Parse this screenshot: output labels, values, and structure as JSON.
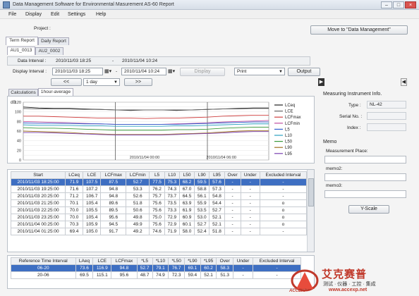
{
  "window": {
    "title": "Data Management Software for Environmental Masurement AS-60 Report"
  },
  "menu": [
    "File",
    "Display",
    "Edit",
    "Settings",
    "Help"
  ],
  "project": {
    "label": "Project :",
    "value": ""
  },
  "move_button": "Move to \"Data Management\"",
  "main_tabs": [
    {
      "label": "Term Report"
    },
    {
      "label": "Daily Report"
    }
  ],
  "sub_tabs": [
    {
      "label": "AU1_0013"
    },
    {
      "label": "AU2_0002"
    }
  ],
  "data_interval": {
    "label": "Data Interval :",
    "start": "2010/11/03 18:25",
    "sep": "-",
    "end": "2010/11/04 10:24"
  },
  "display_interval": {
    "label": "Display Interval :",
    "start": "2010/11/03 18:25",
    "sep": "-",
    "end": "2010/11/04 10:24",
    "display_button": "Display"
  },
  "print": {
    "selected": "Print",
    "output_button": "Output"
  },
  "nav": {
    "prev": "<<",
    "step": "1 day",
    "next": ">>"
  },
  "chart_tabs": [
    {
      "label": "Calculations"
    },
    {
      "label": "1hour-average"
    }
  ],
  "chart_data": {
    "type": "line",
    "ylabel": "dB",
    "ylim": [
      0,
      120
    ],
    "yticks": [
      0,
      10,
      20,
      30,
      40,
      50,
      60,
      70,
      80,
      90,
      100,
      110,
      120
    ],
    "x_labels": [
      "2010/11/03 18:00",
      "2010/11/04 00:00",
      "2010/11/04 06:00"
    ],
    "x_hours": [
      0,
      1,
      2,
      3,
      4,
      5,
      6,
      7,
      8,
      9,
      10,
      11,
      12,
      13,
      14,
      15,
      16
    ],
    "legend_position": "right",
    "series": [
      {
        "name": "LCeq",
        "color": "#222222",
        "values": [
          110,
          108,
          107,
          107,
          106,
          105,
          104,
          103,
          104,
          104,
          103,
          104,
          105,
          106,
          107,
          108,
          108
        ]
      },
      {
        "name": "LCE",
        "color": "#666666",
        "values": [
          107,
          106,
          106,
          106,
          105,
          105,
          104,
          104,
          104,
          104,
          104,
          104,
          105,
          106,
          106,
          107,
          107
        ]
      },
      {
        "name": "LCFmax",
        "color": "#d04040",
        "values": [
          91,
          91,
          90,
          89,
          88,
          87,
          87,
          87,
          86,
          87,
          87,
          88,
          89,
          91,
          92,
          93,
          93
        ]
      },
      {
        "name": "LCFmin",
        "color": "#c04fa0",
        "values": [
          80,
          79,
          78,
          77,
          76,
          75,
          74,
          74,
          74,
          74,
          75,
          76,
          77,
          79,
          80,
          81,
          82
        ]
      },
      {
        "name": "L5",
        "color": "#2f5fd0",
        "values": [
          77,
          76,
          76,
          76,
          75,
          75,
          74,
          74,
          74,
          74,
          74,
          75,
          76,
          77,
          78,
          79,
          79
        ]
      },
      {
        "name": "L10",
        "color": "#2aa0c0",
        "values": [
          73,
          72,
          72,
          72,
          71,
          71,
          70,
          70,
          70,
          70,
          71,
          71,
          72,
          73,
          74,
          75,
          75
        ]
      },
      {
        "name": "L50",
        "color": "#3a9a3a",
        "values": [
          67,
          66,
          66,
          65,
          64,
          63,
          62,
          62,
          62,
          62,
          63,
          63,
          64,
          66,
          67,
          68,
          68
        ]
      },
      {
        "name": "L90",
        "color": "#a07020",
        "values": [
          60,
          59,
          58,
          57,
          55,
          54,
          53,
          53,
          53,
          53,
          54,
          55,
          56,
          58,
          60,
          61,
          61
        ]
      },
      {
        "name": "L95",
        "color": "#7a3fb0",
        "values": [
          57,
          57,
          56,
          55,
          54,
          53,
          52,
          52,
          52,
          52,
          53,
          54,
          55,
          56,
          58,
          59,
          59
        ]
      }
    ]
  },
  "table1": {
    "headers": [
      "Start",
      "LCeq",
      "LCE",
      "LCFmax",
      "LCFmin",
      "L5",
      "L10",
      "L50",
      "L90",
      "L95",
      "Over",
      "Under",
      "Excluded Interval"
    ],
    "rows": [
      [
        "2010/11/03 18:25:00",
        "71.9",
        "107.5",
        "87.5",
        "52.7",
        "77.5",
        "75.3",
        "68.2",
        "59.5",
        "57.6",
        "-",
        "-",
        "-"
      ],
      [
        "2010/11/03 19:25:00",
        "71.6",
        "107.2",
        "94.8",
        "53.3",
        "76.2",
        "74.3",
        "67.0",
        "58.8",
        "57.3",
        "-",
        "-",
        "-"
      ],
      [
        "2010/11/03 20:25:00",
        "71.2",
        "106.7",
        "94.8",
        "52.6",
        "75.7",
        "73.7",
        "64.5",
        "56.1",
        "54.8",
        "-",
        "-",
        "-"
      ],
      [
        "2010/11/03 21:25:00",
        "70.1",
        "105.4",
        "89.6",
        "51.8",
        "75.6",
        "73.5",
        "63.9",
        "55.9",
        "54.4",
        "-",
        "-",
        "o"
      ],
      [
        "2010/11/03 22:25:00",
        "70.0",
        "105.5",
        "89.5",
        "50.6",
        "75.6",
        "73.3",
        "61.9",
        "53.5",
        "52.7",
        "-",
        "-",
        "o"
      ],
      [
        "2010/11/03 23:25:00",
        "70.0",
        "105.4",
        "95.6",
        "49.8",
        "75.0",
        "72.9",
        "60.9",
        "53.0",
        "52.1",
        "-",
        "-",
        "o"
      ],
      [
        "2010/11/04 00:25:00",
        "70.3",
        "105.9",
        "94.5",
        "49.9",
        "75.6",
        "72.9",
        "60.1",
        "52.7",
        "52.1",
        "-",
        "-",
        "o"
      ],
      [
        "2010/11/04 01:25:00",
        "69.4",
        "105.0",
        "91.7",
        "49.2",
        "74.6",
        "71.9",
        "58.0",
        "52.4",
        "51.8",
        "-",
        "-",
        "-"
      ]
    ]
  },
  "table2": {
    "headers": [
      "Reference Time Interval",
      "LAeq",
      "LCE",
      "LCFmax",
      "*L5",
      "*L10",
      "*L50",
      "*L90",
      "*L95",
      "Over",
      "Under",
      "Excluded Interval"
    ],
    "rows": [
      [
        "06-20",
        "73.6",
        "116.9",
        "94.8",
        "52.7",
        "79.1",
        "76.7",
        "69.1",
        "60.2",
        "58.3",
        "-",
        "-"
      ],
      [
        "20-06",
        "69.5",
        "115.1",
        "95.6",
        "48.7",
        "74.9",
        "72.3",
        "59.4",
        "52.1",
        "51.3",
        "-",
        "-"
      ]
    ]
  },
  "right_panel": {
    "section_title": "Measuring Instrument Info.",
    "type_label": "Type :",
    "type_value": "NL-42",
    "serial_label": "Serial No. :",
    "serial_value": "",
    "index_label": "Index :",
    "index_value": "",
    "memo_title": "Memo",
    "place_label": "Measurement Place:",
    "memo2_label": "memo2:",
    "memo3_label": "memo3:",
    "yscale_button": "Y-Scale"
  },
  "watermark": {
    "brand": "艾克赛普",
    "sub": "测试 · 仪器 · 工控 · 集成",
    "url": "www.accexp.net",
    "logo": "ACCEXP"
  }
}
